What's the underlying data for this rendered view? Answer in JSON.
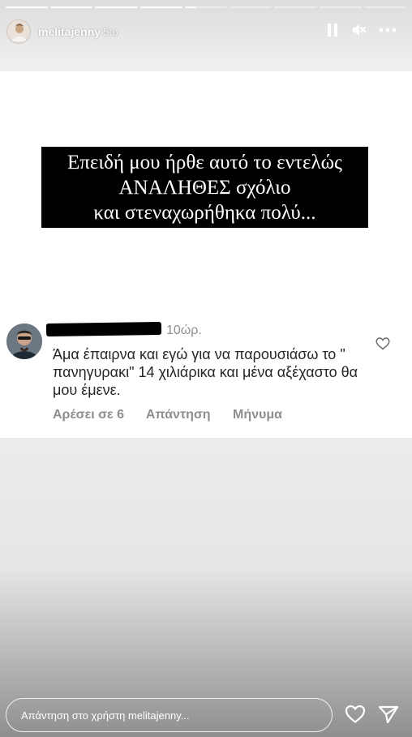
{
  "progress": {
    "segments": [
      1,
      1,
      1,
      1,
      0.25,
      0,
      0,
      0,
      0
    ]
  },
  "header": {
    "username": "melitajenny",
    "time_ago": "5ω",
    "icons": [
      "pause-icon",
      "mute-icon",
      "more-icon"
    ]
  },
  "caption": {
    "text": "Επειδή μου ήρθε αυτό το εντελώς\nΑΝΑΛΗΘΕΣ σχόλιο\nκαι στεναχωρήθηκα πολύ..."
  },
  "comment": {
    "time": "10ώρ.",
    "text": "Άμα έπαιρνα και εγώ για να παρουσιάσω το \" πανηγυρακι\" 14 χιλιάρικα και μένα αξέχαστο θα μου έμενε.",
    "likes_label": "Αρέσει σε 6",
    "reply_label": "Απάντηση",
    "message_label": "Μήνυμα",
    "icons": [
      "heart-icon"
    ]
  },
  "reply": {
    "placeholder": "Απάντηση στο χρήστη melitajenny...",
    "icons": [
      "heart-icon",
      "send-icon"
    ]
  },
  "colors": {
    "caption_bg": "#000000",
    "comment_text": "#262626",
    "muted_text": "#8e8e8e"
  }
}
